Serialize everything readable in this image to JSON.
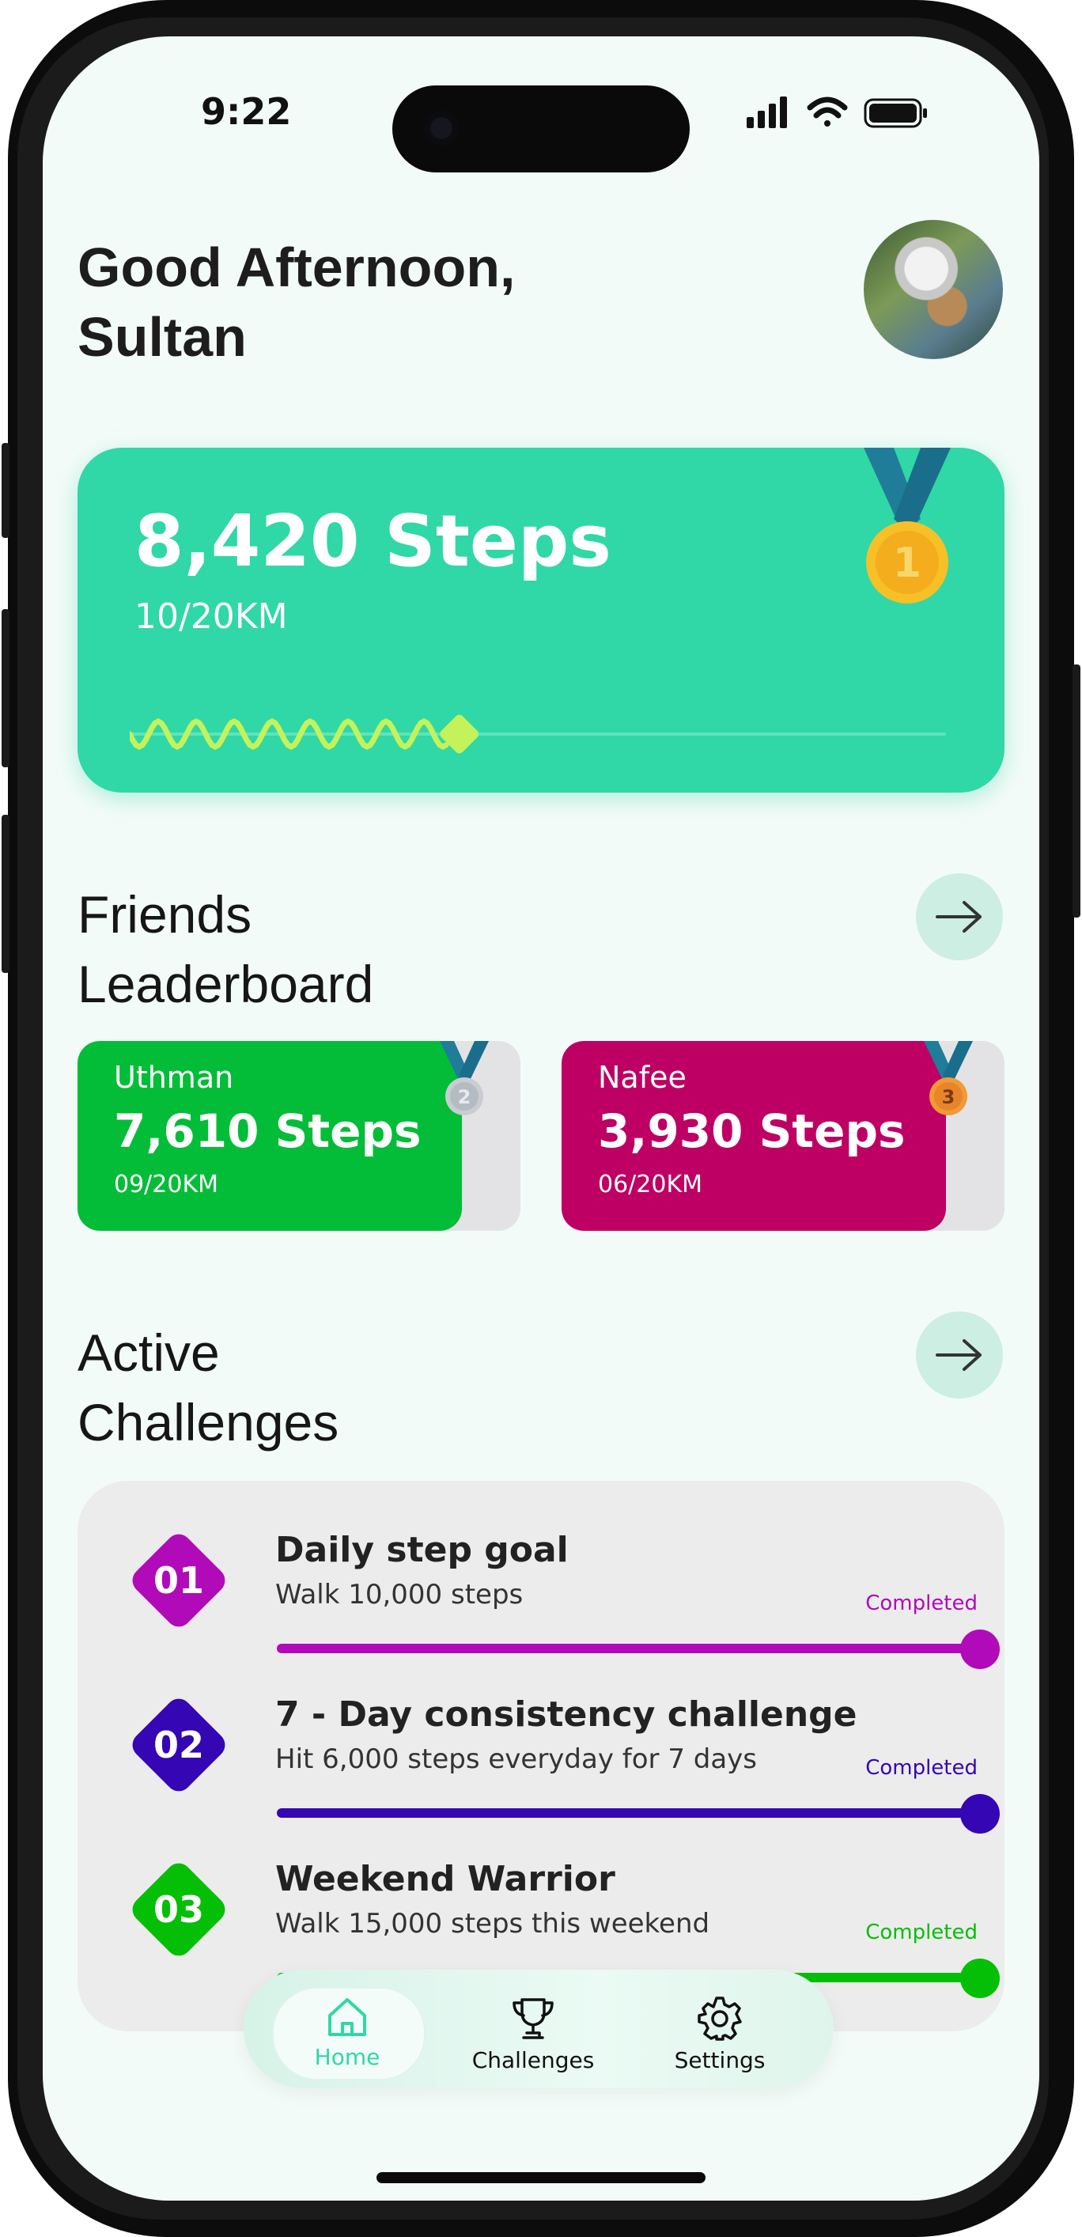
{
  "status_bar": {
    "time": "9:22"
  },
  "greeting": {
    "line1": "Good Afternoon,",
    "line2": "Sultan"
  },
  "steps_card": {
    "steps": "8,420 Steps",
    "distance": "10/20KM",
    "progress": 0.5,
    "medal_rank": "1"
  },
  "leaderboard": {
    "title_line1": "Friends",
    "title_line2": "Leaderboard",
    "friends": [
      {
        "name": "Uthman",
        "steps": "7,610 Steps",
        "distance": "09/20KM",
        "medal_rank": "2",
        "color": "#03bd38"
      },
      {
        "name": "Nafee",
        "steps": "3,930 Steps",
        "distance": "06/20KM",
        "medal_rank": "3",
        "color": "#be0064"
      }
    ]
  },
  "challenges": {
    "title_line1": "Active",
    "title_line2": "Challenges",
    "items": [
      {
        "number": "01",
        "title": "Daily step goal",
        "description": "Walk 10,000 steps",
        "status": "Completed",
        "color": "#b10ab8"
      },
      {
        "number": "02",
        "title": "7 - Day consistency challenge",
        "description": "Hit 6,000 steps everyday for 7 days",
        "status": "Completed",
        "color": "#3406b4"
      },
      {
        "number": "03",
        "title": "Weekend Warrior",
        "description": "Walk 15,000 steps this weekend",
        "status": "Completed",
        "color": "#05bf06"
      }
    ]
  },
  "tab_bar": {
    "tabs": [
      {
        "label": "Home",
        "icon": "home-icon",
        "active": true
      },
      {
        "label": "Challenges",
        "icon": "trophy-icon",
        "active": false
      },
      {
        "label": "Settings",
        "icon": "gear-icon",
        "active": false
      }
    ]
  },
  "colors": {
    "accent": "#2fd8a6",
    "background": "#f3fbf8"
  }
}
